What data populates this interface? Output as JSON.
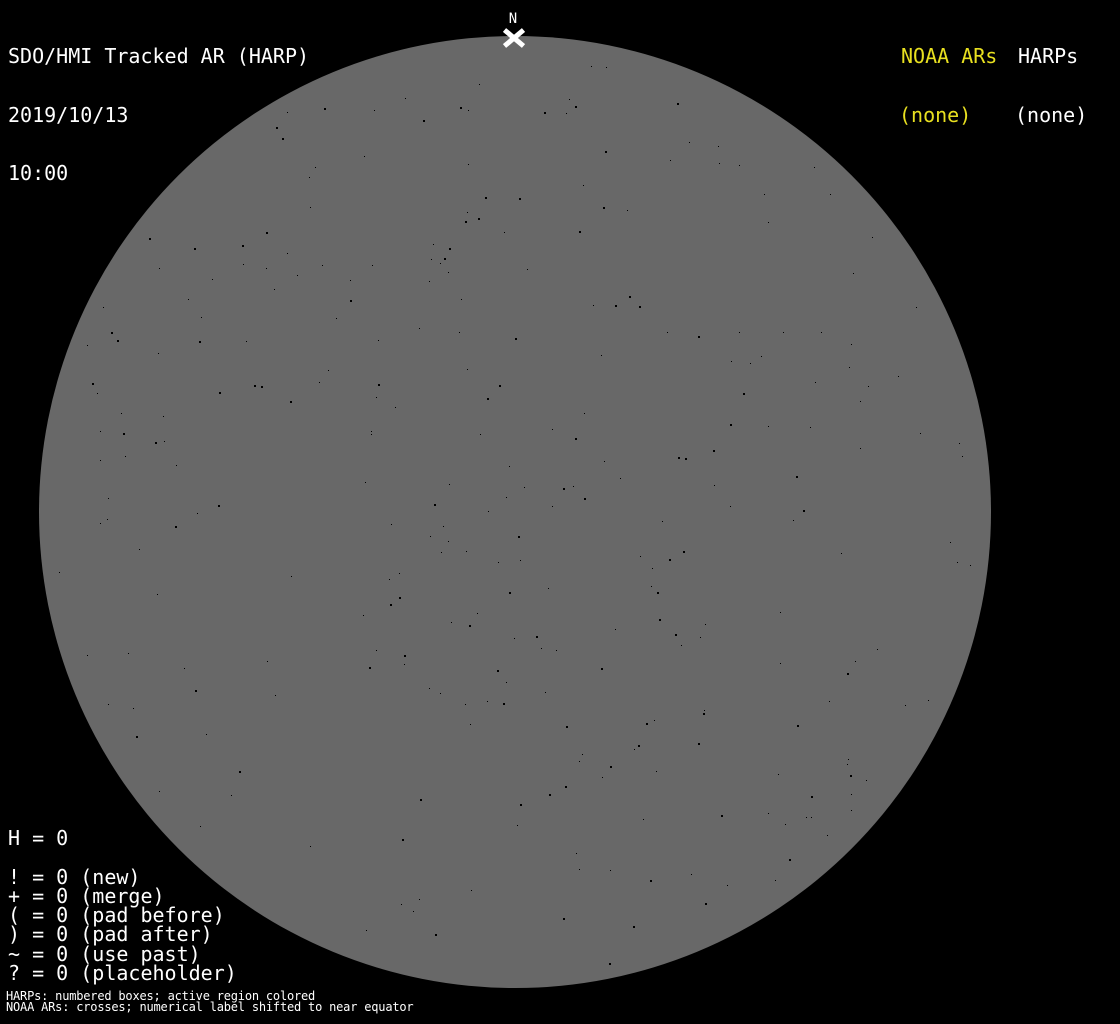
{
  "header": {
    "title": "SDO/HMI Tracked AR (HARP)",
    "date": "2019/10/13",
    "time": "10:00"
  },
  "north_marker": {
    "label": "N"
  },
  "region_status": {
    "noaa": {
      "label": "NOAA ARs",
      "value": "(none)"
    },
    "harps": {
      "label": "HARPs",
      "value": "(none)"
    }
  },
  "counters": {
    "lines": [
      "H = 0",
      "",
      "! = 0 (new)",
      "+ = 0 (merge)",
      "( = 0 (pad before)",
      ") = 0 (pad after)",
      "~ = 0 (use past)",
      "? = 0 (placeholder)"
    ]
  },
  "footer": {
    "lines": [
      "HARPs: numbered boxes; active region colored",
      "NOAA ARs: crosses; numerical label shifted to near equator"
    ]
  },
  "colors": {
    "background": "#000000",
    "disk": "#686868",
    "text": "#ffffff",
    "accent_yellow": "#e8e020"
  }
}
